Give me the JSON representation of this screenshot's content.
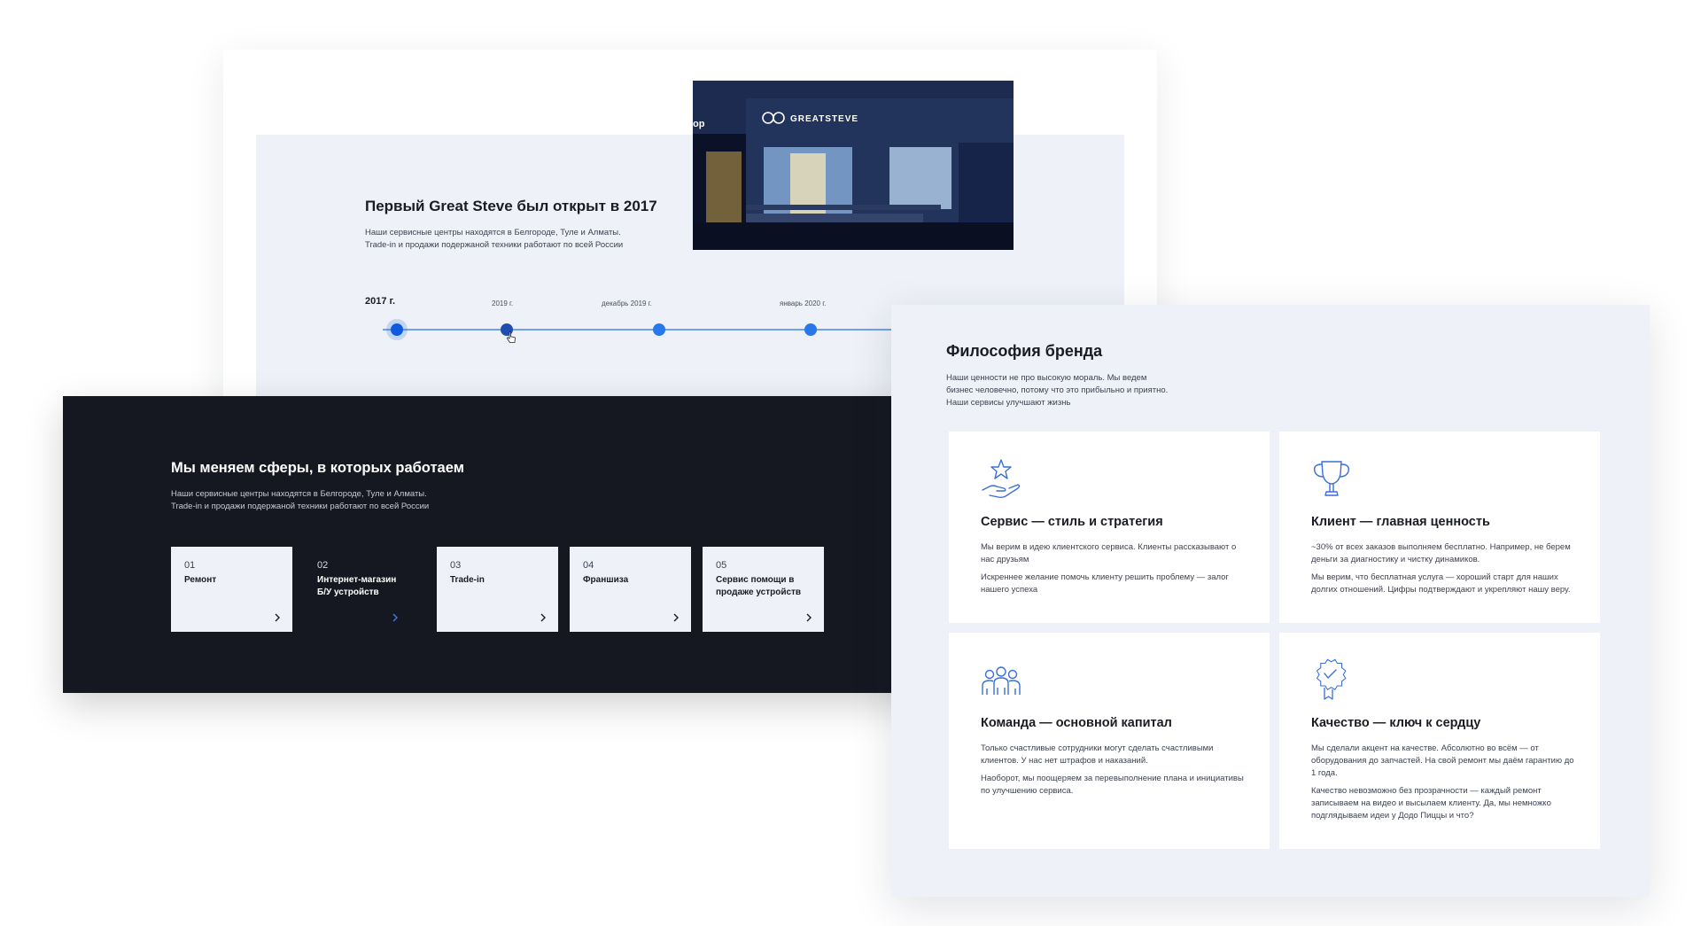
{
  "history": {
    "title": "Первый Great Steve был открыт в 2017",
    "text_lines": [
      "Наши сервисные центры находятся в Белгороде, Туле и Алматы.",
      "Trade-in и продажи подержаной техники работают по всей России"
    ],
    "photo_sign": "GREATSTEVE",
    "timeline": [
      {
        "label": "2017 г.",
        "active": true
      },
      {
        "label": "2019 г.",
        "active": false
      },
      {
        "label": "декабрь 2019 г.",
        "active": false
      },
      {
        "label": "январь 2020 г.",
        "active": false
      }
    ]
  },
  "spheres": {
    "title": "Мы меняем сферы, в которых работаем",
    "text_lines": [
      "Наши сервисные центры находятся в Белгороде, Туле и Алматы.",
      "Trade-in и продажи подержаной техники работают по всей России"
    ],
    "tiles": [
      {
        "num": "01",
        "label": "Ремонт",
        "style": "light"
      },
      {
        "num": "02",
        "label": "Интернет-магазин Б/У устройств",
        "style": "dark"
      },
      {
        "num": "03",
        "label": "Trade-in",
        "style": "light"
      },
      {
        "num": "04",
        "label": "Франшиза",
        "style": "light"
      },
      {
        "num": "05",
        "label": "Сервис помощи в продаже устройств",
        "style": "light"
      }
    ],
    "arrow_color_dark": "#3d7fe6"
  },
  "philosophy": {
    "title": "Философия бренда",
    "text_lines": [
      "Наши ценности не про высокую мораль. Мы ведем",
      "бизнес человечно, потому что это прибыльно и приятно.",
      "Наши сервисы улучшают жизнь"
    ],
    "values": [
      {
        "icon": "hand-star-icon",
        "title": "Сервис — стиль и стратегия",
        "paragraphs": [
          "Мы верим в идею клиентского сервиса. Клиенты рассказывают о нас друзьям",
          "Искреннее желание помочь клиенту решить проблему — залог нашего успеха"
        ]
      },
      {
        "icon": "trophy-icon",
        "title": "Клиент — главная ценность",
        "paragraphs": [
          "~30% от всех заказов выполняем бесплатно. Например, не берем деньги за диагностику и чистку динамиков.",
          "Мы верим, что бесплатная услуга — хороший старт для наших долгих отношений. Цифры подтверждают и укрепляют нашу веру."
        ]
      },
      {
        "icon": "team-icon",
        "title": "Команда — основной капитал",
        "paragraphs": [
          "Только счастливые сотрудники могут сделать счастливыми клиентов. У нас нет штрафов и наказаний.",
          "Наоборот, мы поощеряем за перевыполнение плана и инициативы по улучшению сервиса."
        ]
      },
      {
        "icon": "quality-badge-icon",
        "title": "Качество — ключ к сердцу",
        "paragraphs": [
          "Мы сделали акцент на качестве. Абсолютно во всём — от оборудования до запчастей. На свой ремонт мы даём гарантию до 1 года.",
          "Качество невозможно без прозрачности — каждый ремонт записываем на видео и высылаем клиенту. Да, мы немножко подглядываем идеи у Додо Пиццы и что?"
        ]
      }
    ],
    "icon_color": "#3a6fd8"
  }
}
